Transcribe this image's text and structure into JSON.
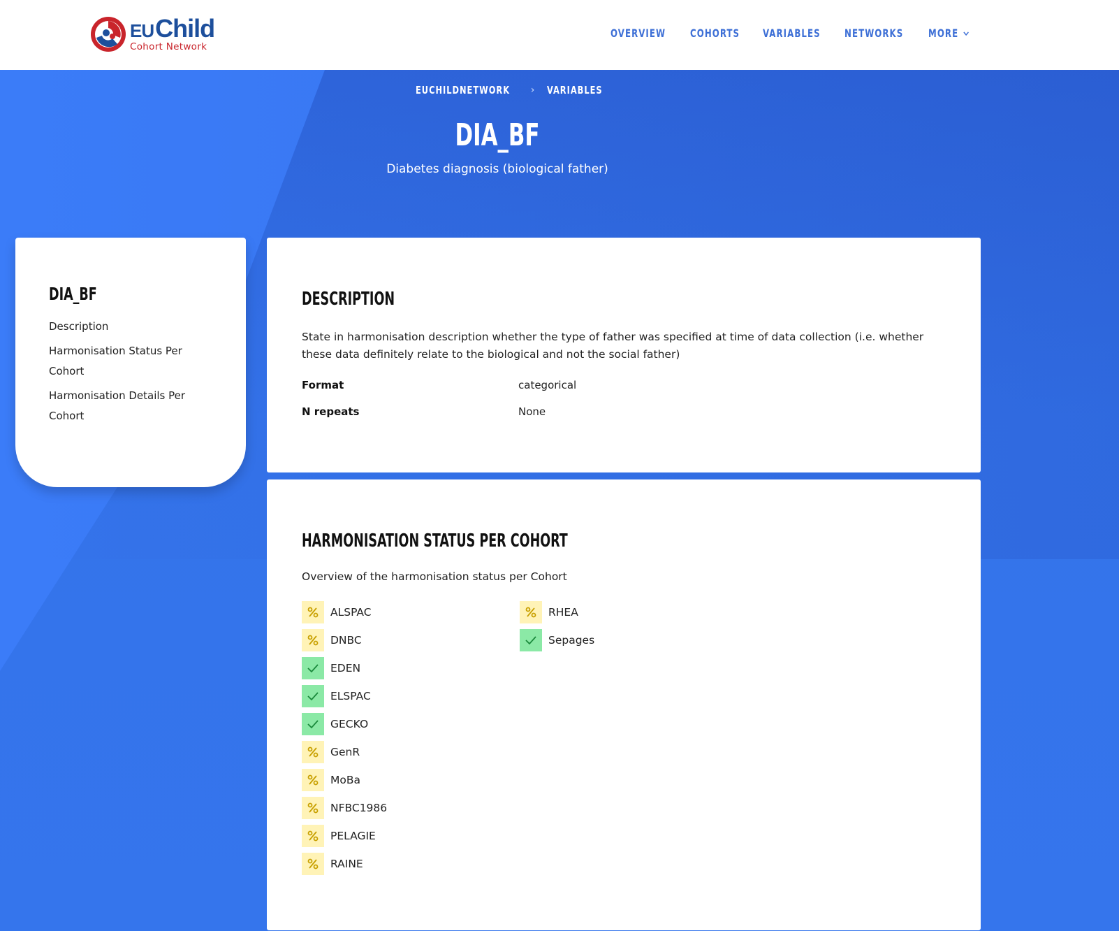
{
  "header": {
    "logo": {
      "eu": "EU",
      "child": "Child",
      "sub": "Cohort Network"
    },
    "nav": [
      {
        "label": "OVERVIEW"
      },
      {
        "label": "COHORTS"
      },
      {
        "label": "VARIABLES"
      },
      {
        "label": "NETWORKS"
      },
      {
        "label": "MORE"
      }
    ]
  },
  "breadcrumb": [
    {
      "label": "EUCHILDNETWORK"
    },
    {
      "label": "VARIABLES"
    }
  ],
  "breadcrumb_separator": "›",
  "hero": {
    "title": "DIA_BF",
    "subtitle": "Diabetes diagnosis (biological father)"
  },
  "sidebar": {
    "title": "DIA_BF",
    "links": [
      {
        "label": "Description"
      },
      {
        "label": "Harmonisation Status Per Cohort"
      },
      {
        "label": "Harmonisation Details Per Cohort"
      }
    ]
  },
  "description": {
    "title": "DESCRIPTION",
    "text": "State in harmonisation description whether the type of father was specified at time of data collection (i.e. whether these data definitely relate to the biological and not the social father)",
    "properties": [
      {
        "key": "Format",
        "value": "categorical"
      },
      {
        "key": "N repeats",
        "value": "None"
      }
    ]
  },
  "harmonisation": {
    "title": "HARMONISATION STATUS PER COHORT",
    "subtitle": "Overview of the harmonisation status per Cohort",
    "partial_icon": "percent-icon",
    "complete_icon": "check-icon",
    "colors": {
      "partial_bg": "#fff3b7",
      "partial_fg": "#c8a000",
      "complete_bg": "#8be9a6",
      "complete_fg": "#1a8a3c"
    },
    "cohorts": [
      {
        "name": "ALSPAC",
        "status": "partial"
      },
      {
        "name": "DNBC",
        "status": "partial"
      },
      {
        "name": "EDEN",
        "status": "complete"
      },
      {
        "name": "ELSPAC",
        "status": "complete"
      },
      {
        "name": "GECKO",
        "status": "complete"
      },
      {
        "name": "GenR",
        "status": "partial"
      },
      {
        "name": "MoBa",
        "status": "partial"
      },
      {
        "name": "NFBC1986",
        "status": "partial"
      },
      {
        "name": "PELAGIE",
        "status": "partial"
      },
      {
        "name": "RAINE",
        "status": "partial"
      },
      {
        "name": "RHEA",
        "status": "partial"
      },
      {
        "name": "Sepages",
        "status": "complete"
      }
    ]
  }
}
